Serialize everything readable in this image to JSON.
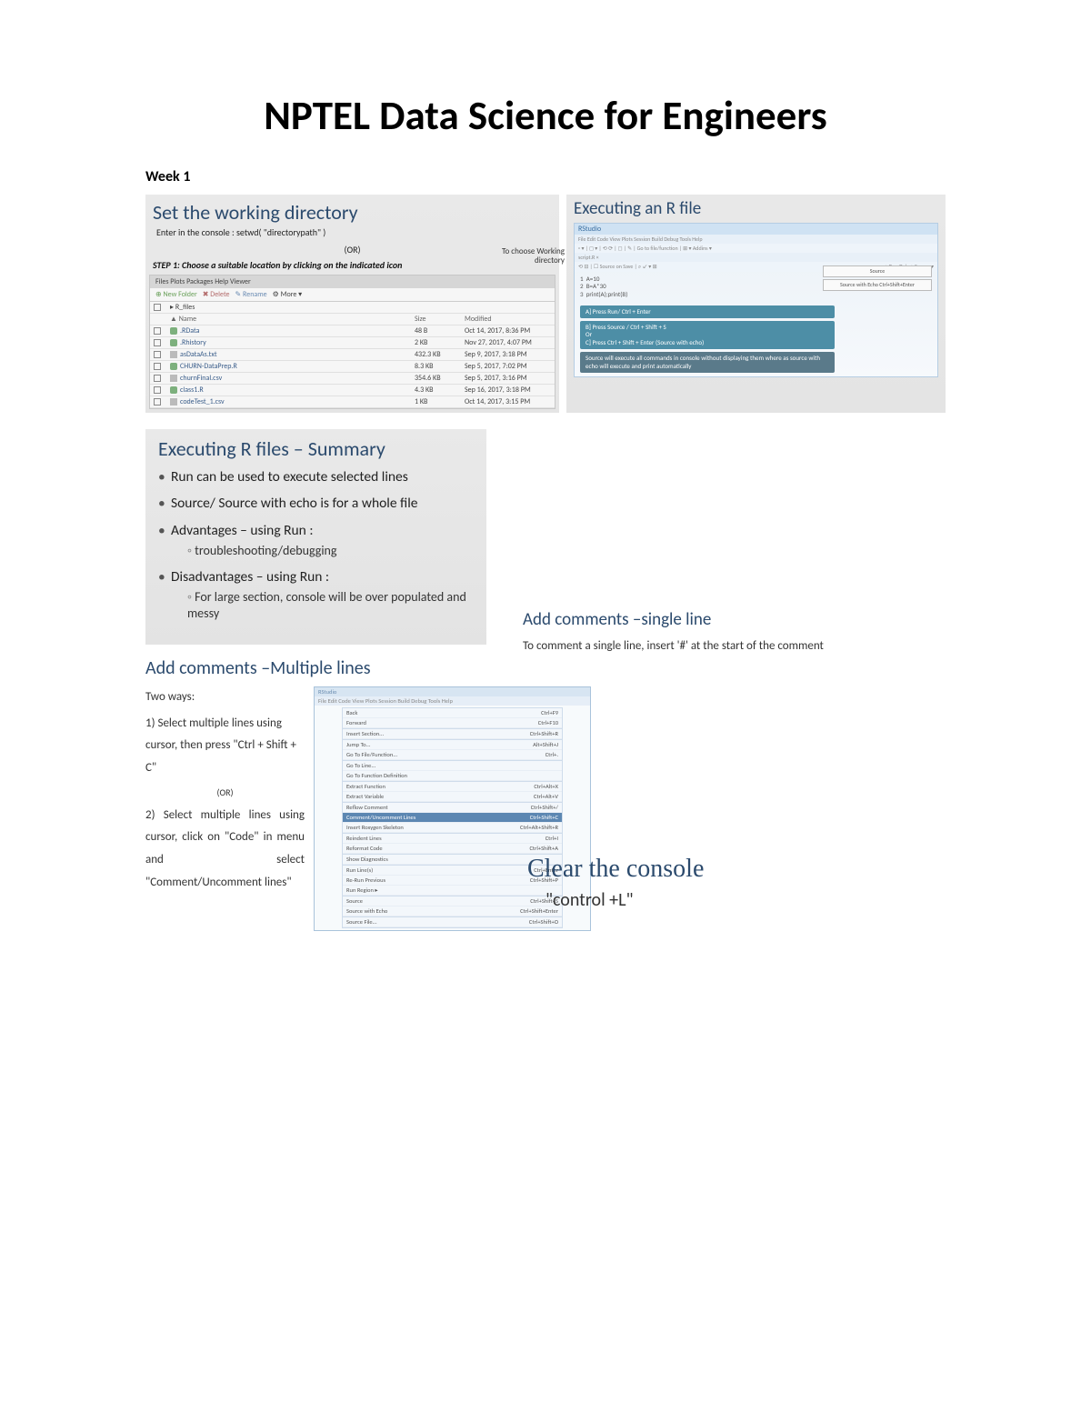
{
  "doc": {
    "title": "NPTEL Data Science for Engineers",
    "week": "Week 1"
  },
  "wd": {
    "heading": "Set the working directory",
    "sub": "Enter in the console : setwd( \"directorypath\" )",
    "or": "(OR)",
    "step1": "STEP 1: Choose a suitable location by clicking on the indicated icon",
    "balloon1": "To choose Working",
    "balloon2": "directory",
    "tabs": "Files   Plots   Packages   Help   Viewer",
    "tool_new": "New Folder",
    "tool_del": "Delete",
    "tool_ren": "Rename",
    "tool_more": "More ▾",
    "path": "▸  R_files",
    "hdr_name": "▲ Name",
    "hdr_size": "Size",
    "hdr_mod": "Modified",
    "rows": [
      {
        "name": ".RData",
        "size": "48 B",
        "mod": "Oct 14, 2017, 8:36 PM",
        "icon": "p-rfile"
      },
      {
        "name": ".Rhistory",
        "size": "2 KB",
        "mod": "Nov 27, 2017, 4:07 PM",
        "icon": "p-rfile"
      },
      {
        "name": "asDataAs.txt",
        "size": "432.3 KB",
        "mod": "Sep 9, 2017, 3:18 PM",
        "icon": "p-file"
      },
      {
        "name": "CHURN-DataPrep.R",
        "size": "8.3 KB",
        "mod": "Sep 5, 2017, 7:02 PM",
        "icon": "p-rfile"
      },
      {
        "name": "churnFinal.csv",
        "size": "354.6 KB",
        "mod": "Sep 5, 2017, 3:16 PM",
        "icon": "p-file"
      },
      {
        "name": "class1.R",
        "size": "4.3 KB",
        "mod": "Sep 16, 2017, 3:18 PM",
        "icon": "p-rfile"
      },
      {
        "name": "codeTest_1.csv",
        "size": "1 KB",
        "mod": "Oct 14, 2017, 3:15 PM",
        "icon": "p-file"
      }
    ]
  },
  "exec": {
    "heading": "Executing an R file",
    "rs_title": "RStudio",
    "rs_menu": "File  Edit  Code  View  Plots  Session  Build  Debug  Tools  Help",
    "rs_tool": "◦ ▾ | ◻ ▾ | ⟲ ⟳ | ◻ | ✎ | Go to file/function    |  ⊞ ▾  Addins ▾",
    "rs_script": "script.R ×",
    "rs_srcbar": "⟲  ⊟ | ☐ Source on Save | ⌕  ↙ ▾  ⊞",
    "rs_line1": "1",
    "rs_code1": "A=10",
    "rs_line2": "2",
    "rs_code2": "B=A*30",
    "rs_line3": "3",
    "rs_code3": "print(A);print(B)",
    "rs_runrow": "→ Run    ↷ | → Source ▾",
    "rs_btn1": "Source",
    "rs_btn2": "Source with Echo    Ctrl+Shift+Enter",
    "co_a": "A] Press Run/ Ctrl + Enter",
    "co_b": "B] Press Source / Ctrl + Shift + S",
    "co_or": "Or",
    "co_c": "C] Press Ctrl + Shift + Enter (Source with echo)",
    "co_note": "Source will execute all commands in console without displaying them  where as source with echo will execute and print automatically"
  },
  "summary": {
    "heading": "Executing R files – Summary",
    "b1": "Run can be used to execute selected lines",
    "b2": "Source/ Source with echo is for a whole file",
    "b3": "Advantages – using Run :",
    "b3s": "troubleshooting/debugging",
    "b4": "Disadvantages – using Run :",
    "b4s": "For large section, console will be over populated and messy"
  },
  "cmt1": {
    "heading": "Add comments –single line",
    "body": "To comment a single line,  insert  '#'  at the start of the comment"
  },
  "cmtM": {
    "heading": "Add comments –Multiple lines",
    "two": "Two ways:",
    "p1": "1) Select multiple lines using cursor, then press \"Ctrl + Shift + C\"",
    "or": "(OR)",
    "p2": "2) Select multiple lines using cursor, click on \"Code\" in menu and select \"Comment/Uncomment lines\"",
    "menu_title": "RStudio",
    "menu_bar": "File  Edit  Code  View  Plots  Session  Build  Debug  Tools  Help",
    "items": [
      {
        "l": "Back",
        "r": "Ctrl+F9"
      },
      {
        "l": "Forward",
        "r": "Ctrl+F10"
      },
      {
        "sep": true
      },
      {
        "l": "Insert Section...",
        "r": "Ctrl+Shift+R"
      },
      {
        "sep": true
      },
      {
        "l": "Jump To...",
        "r": "Alt+Shift+J"
      },
      {
        "l": "Go To File/Function...",
        "r": "Ctrl+."
      },
      {
        "sep": true
      },
      {
        "l": "Go To Line...",
        "r": ""
      },
      {
        "l": "Go To Function Definition",
        "r": ""
      },
      {
        "sep": true
      },
      {
        "l": "Extract Function",
        "r": "Ctrl+Alt+X"
      },
      {
        "l": "Extract Variable",
        "r": "Ctrl+Alt+V"
      },
      {
        "sep": true
      },
      {
        "l": "Reflow Comment",
        "r": "Ctrl+Shift+/"
      },
      {
        "l": "Comment/Uncomment Lines",
        "r": "Ctrl+Shift+C",
        "sel": true
      },
      {
        "l": "Insert Roxygen Skeleton",
        "r": "Ctrl+Alt+Shift+R"
      },
      {
        "sep": true
      },
      {
        "l": "Reindent Lines",
        "r": "Ctrl+I"
      },
      {
        "l": "Reformat Code",
        "r": "Ctrl+Shift+A"
      },
      {
        "sep": true
      },
      {
        "l": "Show Diagnostics",
        "r": ""
      },
      {
        "sep": true
      },
      {
        "l": "Run Line(s)",
        "r": "Ctrl+Enter"
      },
      {
        "l": "Re-Run Previous",
        "r": "Ctrl+Shift+P"
      },
      {
        "l": "Run Region  ▸",
        "r": ""
      },
      {
        "sep": true
      },
      {
        "l": "Source",
        "r": "Ctrl+Shift+S"
      },
      {
        "l": "Source with Echo",
        "r": "Ctrl+Shift+Enter"
      },
      {
        "sep": true
      },
      {
        "l": "Source File...",
        "r": "Ctrl+Shift+O"
      }
    ]
  },
  "clear": {
    "heading": "Clear the console",
    "body": "\"control +L\""
  }
}
